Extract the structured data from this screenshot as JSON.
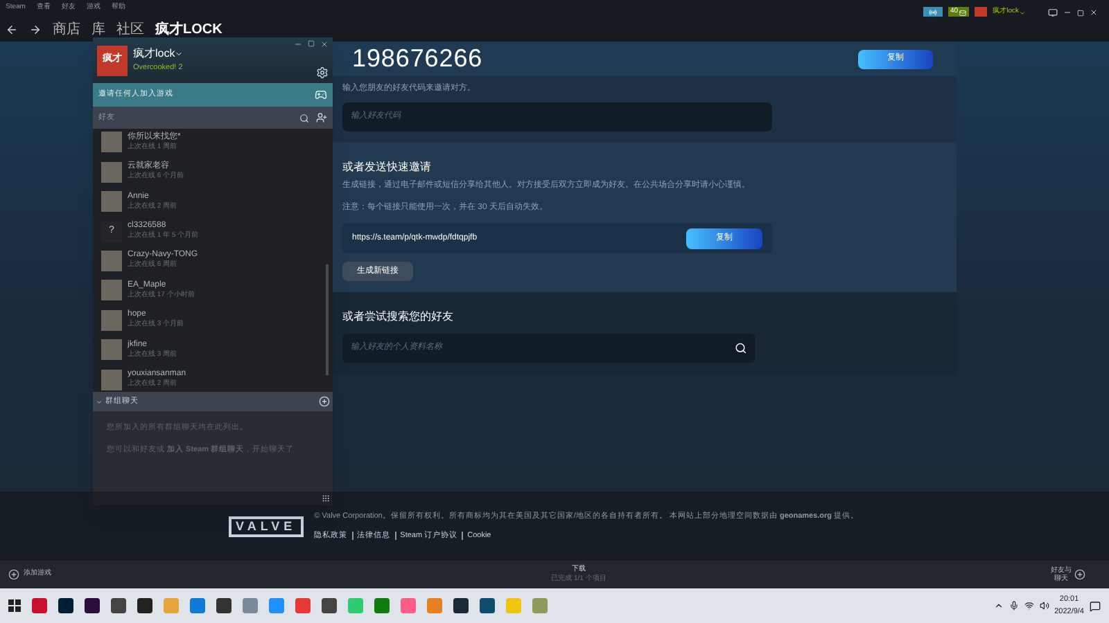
{
  "menu": [
    "Steam",
    "查看",
    "好友",
    "游戏",
    "帮助"
  ],
  "top_right": {
    "notifications": "40",
    "user": "疯才lock"
  },
  "nav": [
    {
      "label": "商店",
      "selected": false
    },
    {
      "label": "库",
      "selected": false
    },
    {
      "label": "社区",
      "selected": false
    },
    {
      "label": "疯才LOCK",
      "selected": true
    }
  ],
  "friends_window": {
    "avatar_text": "疯才",
    "name": "疯才lock",
    "game": "Overcooked! 2",
    "invite": "邀请任何人加入游戏",
    "search_placeholder": "好友",
    "friends": [
      {
        "name": "你所以来找您*",
        "status": "上次在线 1 周前"
      },
      {
        "name": "云就家老容",
        "status": "上次在线 6 个月前"
      },
      {
        "name": "Annie",
        "status": "上次在线 2 周前"
      },
      {
        "name": "cl3326588",
        "status": "上次在线 1 年 5 个月前",
        "avatar_text": "?"
      },
      {
        "name": "Crazy-Navy-TONG",
        "status": "上次在线 6 周前"
      },
      {
        "name": "EA_Maple",
        "status": "上次在线 17 个小时前"
      },
      {
        "name": "hope",
        "status": "上次在线 3 个月前"
      },
      {
        "name": "jkfine",
        "status": "上次在线 3 周前"
      },
      {
        "name": "youxiansanman",
        "status": "上次在线 2 周前"
      }
    ],
    "group_header": "群组聊天",
    "group_expanded": true,
    "group_texts": [
      "您所加入的所有群组聊天均在此列出。",
      "您可以和好友或 **加入 Steam 群组聊天**，开始聊天了"
    ]
  },
  "friend_code": {
    "code": "198676266",
    "copy": "复制",
    "hint": "输入您朋友的好友代码来邀请对方。",
    "placeholder": "输入好友代码"
  },
  "quick_invite": {
    "title": "或者发送快速邀请",
    "description": "生成链接，通过电子邮件或短信分享给其他人。对方接受后双方立即成为好友。在公共场合分享时请小心谨慎。",
    "note": "注意：每个链接只能使用一次，并在 30 天后自动失效。",
    "link": "https://s.team/p/qtk-mwdp/fdtqpjfb",
    "copy": "复制",
    "generate": "生成新链接"
  },
  "search_friends": {
    "title": "或者尝试搜索您的好友",
    "placeholder": "输入好友的个人资料名称"
  },
  "footer": {
    "logo": "VALVE",
    "text": "© Valve Corporation。保留所有权利。所有商标均为其在美国及其它国家/地区的各自持有者所有。 本网站上部分地理空间数据由 **geonames.org** 提供。",
    "links": [
      "隐私政策",
      "法律信息",
      "Steam 订户协议",
      "Cookie"
    ]
  },
  "bottom_bar": {
    "add_game": "添加游戏",
    "downloads": "下载",
    "downloads_status": "已完成 1/1 个项目",
    "friends_chat": "好友与聊天"
  },
  "taskbar": {
    "time": "20:01",
    "date": "2022/9/4"
  }
}
